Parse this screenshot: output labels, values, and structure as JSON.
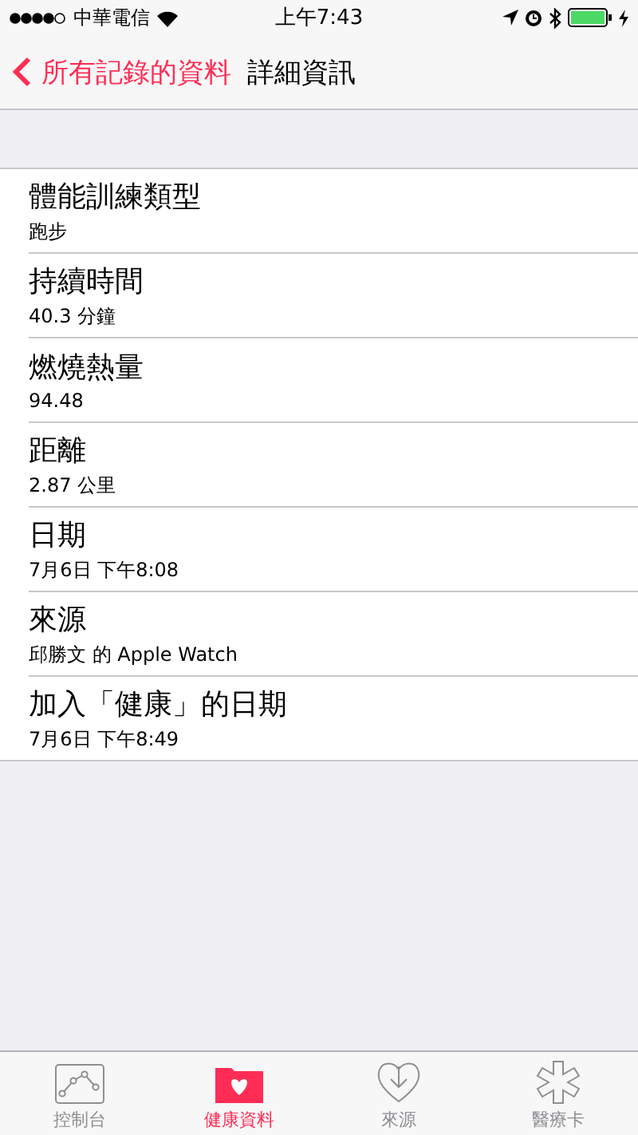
{
  "status_bar": {
    "carrier": "中華電信",
    "time": "上午7:43"
  },
  "nav": {
    "back": "所有記錄的資料",
    "title": "詳細資訊"
  },
  "rows": [
    {
      "label": "體能訓練類型",
      "value": "跑步"
    },
    {
      "label": "持續時間",
      "value": "40.3 分鐘"
    },
    {
      "label": "燃燒熱量",
      "value": "94.48"
    },
    {
      "label": "距離",
      "value": "2.87 公里"
    },
    {
      "label": "日期",
      "value": "7月6日 下午8:08"
    },
    {
      "label": "來源",
      "value": "邱勝文 的 Apple Watch"
    },
    {
      "label": "加入「健康」的日期",
      "value": "7月6日 下午8:49"
    }
  ],
  "tabs": [
    {
      "kind": "dashboard",
      "label": "控制台",
      "selected": false
    },
    {
      "kind": "health",
      "label": "健康資料",
      "selected": true
    },
    {
      "kind": "sources",
      "label": "來源",
      "selected": false
    },
    {
      "kind": "medical",
      "label": "醫療卡",
      "selected": false
    }
  ]
}
